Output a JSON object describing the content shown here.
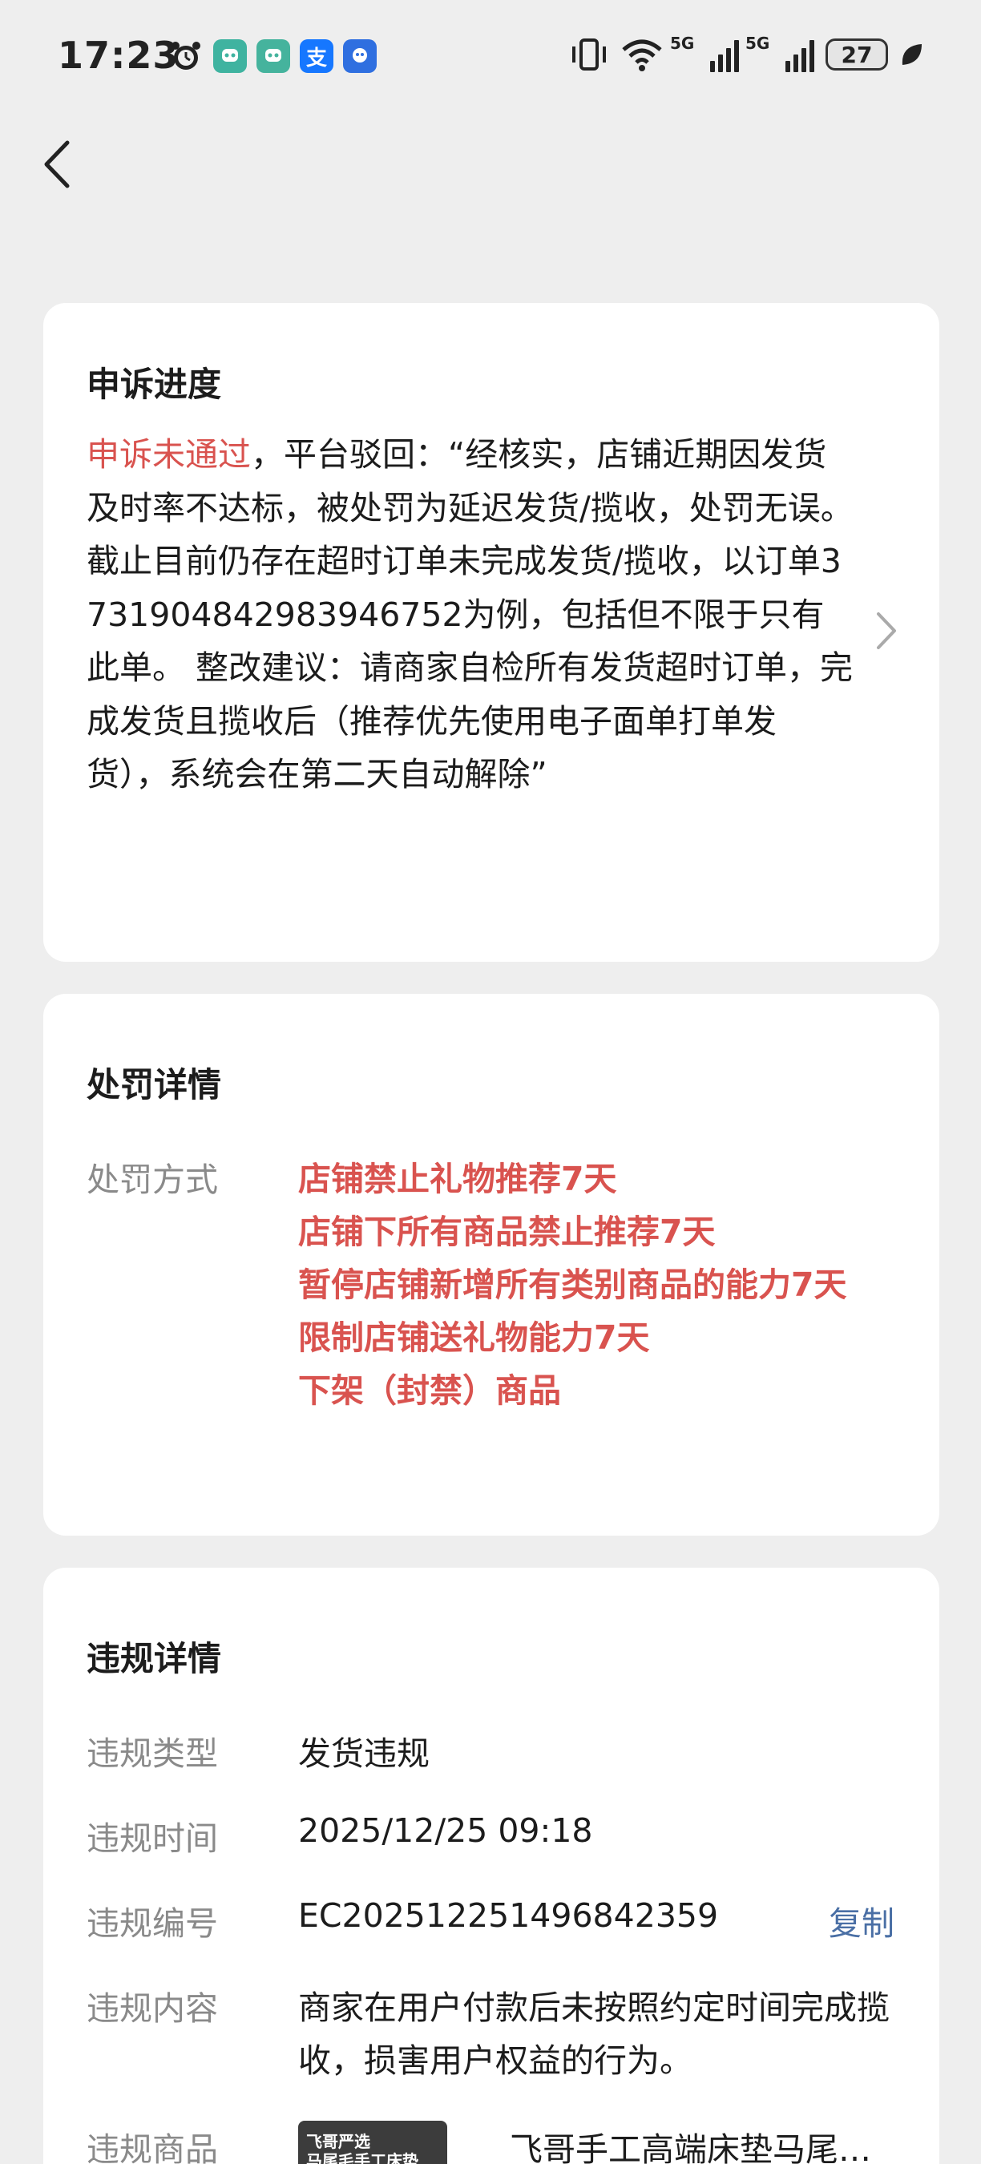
{
  "status_bar": {
    "time": "17:23",
    "network_label_1": "5G",
    "network_label_2": "5G",
    "battery": "27",
    "app_icons": [
      "alarm-icon",
      "app-green-icon",
      "app-green2-icon",
      "alipay-icon",
      "app-blue-icon"
    ],
    "alipay_glyph": "支"
  },
  "appeal_card": {
    "title": "申诉进度",
    "status": "申诉未通过",
    "body": "，平台驳回：“经核实，店铺近期因发货及时率不达标，被处罚为延迟发货/揽收，处罚无误。截止目前仍存在超时订单未完成发货/揽收，以订单3731904842983946752为例，包括但不限于只有此单。 整改建议：请商家自检所有发货超时订单，完成发货且揽收后（推荐优先使用电子面单打单发货），系统会在第二天自动解除”"
  },
  "penalty_card": {
    "title": "处罚详情",
    "method_label": "处罚方式",
    "methods": [
      "店铺禁止礼物推荐7天",
      "店铺下所有商品禁止推荐7天",
      "暂停店铺新增所有类别商品的能力7天",
      "限制店铺送礼物能力7天",
      "下架（封禁）商品"
    ]
  },
  "violation_card": {
    "title": "违规详情",
    "type_label": "违规类型",
    "type_value": "发货违规",
    "time_label": "违规时间",
    "time_value": "2025/12/25 09:18",
    "id_label": "违规编号",
    "id_value": "EC202512251496842359",
    "copy_label": "复制",
    "content_label": "违规内容",
    "content_value": "商家在用户付款后未按照约定时间完成揽收，损害用户权益的行为。",
    "product_label": "违规商品",
    "product_thumb_line1": "飞哥严选",
    "product_thumb_line2": "马尾毛手工床垫",
    "product_name": "飞哥手工高端床垫马尾…"
  },
  "colors": {
    "background": "#eeeeee",
    "card": "#ffffff",
    "accent_red": "#d9534f",
    "link_blue": "#4a6fa5",
    "label_gray": "#8a8a8a"
  }
}
